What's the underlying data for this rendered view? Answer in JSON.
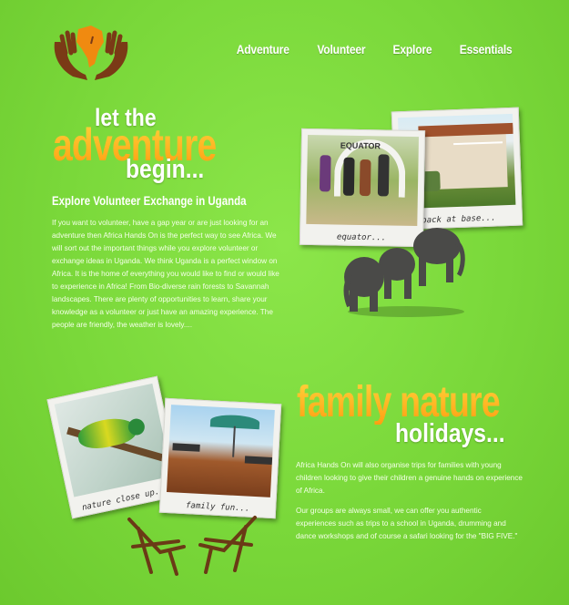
{
  "nav": {
    "items": [
      {
        "label": "Adventure"
      },
      {
        "label": "Volunteer"
      },
      {
        "label": "Explore"
      },
      {
        "label": "Essentials"
      }
    ]
  },
  "hero": {
    "line1": "let the",
    "line2": "adventure",
    "line3": "begin...",
    "subtitle": "Explore Volunteer Exchange in Uganda",
    "body": "If you want to volunteer, have a gap year or are just looking for an adventure then Africa Hands On is the perfect way to see Africa. We will sort out the important things while you explore volunteer or exchange ideas in Uganda. We think Uganda is a perfect window on Africa. It is the home of everything you would like to find or would like to experience in Africa! From Bio-diverse rain forests to Savannah landscapes. There are plenty of opportunities to learn, share your knowledge as a volunteer or just have an amazing experience. The people are friendly, the weather is lovely...."
  },
  "photos_top": {
    "left_caption": "equator...",
    "right_caption": "back at base...",
    "sign_text": "EQUATOR"
  },
  "family": {
    "line1": "family nature",
    "line2": "holidays...",
    "para1": "Africa Hands On will also organise trips for families with young children looking to give their children a genuine hands on experience of Africa.",
    "para2": "Our groups are always small, we can offer you authentic experiences such as trips to a school in Uganda, drumming and dance workshops and of course a safari looking for the \"BIG FIVE.\""
  },
  "photos_bottom": {
    "left_caption": "nature close up...",
    "right_caption": "family fun..."
  },
  "colors": {
    "background": "#7ad83a",
    "heading_orange": "#ff9f12",
    "logo_brown": "#7a3a16"
  },
  "icons": {
    "logo": "hands-holding-africa-icon"
  }
}
